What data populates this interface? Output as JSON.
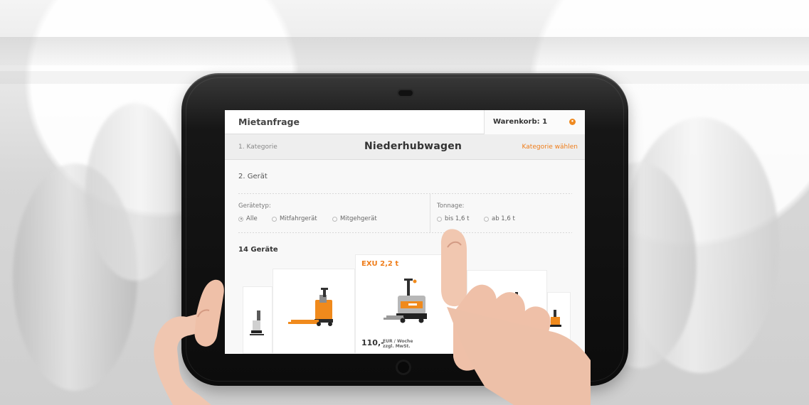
{
  "screen": {
    "title": "Mietanfrage",
    "cart_label": "Warenkorb: 1",
    "cart_indicator": "•",
    "step_1": "1. Kategorie",
    "category_title": "Niederhubwagen",
    "category_link": "Kategorie wählen",
    "step_2": "2. Gerät",
    "filter_group_1_label": "Gerätetyp:",
    "filter_group_2_label": "Tonnage:",
    "filter_options": [
      "Alle",
      "Mitfahrgerät",
      "Mitgehgerät",
      "bis 1,6 t",
      "ab 1,6 t"
    ],
    "count_label": "14 Geräte",
    "featured_product": {
      "name": "EXU 2,2 t",
      "price": "110,-",
      "price_note": "EUR / Woche zzgl. MwSt."
    }
  },
  "colors": {
    "accent": "#ef7d1a",
    "tablet": "#111111",
    "screen": "#f8f8f8",
    "orange_machine": "#f08a1c",
    "silver_machine": "#b7b7b7"
  }
}
